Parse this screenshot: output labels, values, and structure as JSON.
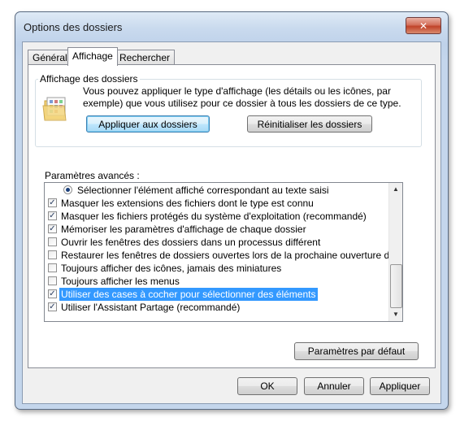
{
  "window": {
    "title": "Options des dossiers",
    "close_glyph": "✕"
  },
  "tabs": [
    "Général",
    "Affichage",
    "Rechercher"
  ],
  "active_tab": "Affichage",
  "folder_views": {
    "title": "Affichage des dossiers",
    "description": "Vous pouvez appliquer le type d'affichage (les détails ou les icônes, par exemple) que vous utilisez pour ce dossier à tous les dossiers de ce type.",
    "apply_button": "Appliquer aux dossiers",
    "reset_button": "Réinitialiser les dossiers",
    "icon": "folder-views-icon"
  },
  "advanced": {
    "label": "Paramètres avancés :",
    "items": [
      {
        "type": "radio",
        "checked": true,
        "label": "Sélectionner l'élément affiché correspondant au texte saisi"
      },
      {
        "type": "checkbox",
        "checked": true,
        "label": "Masquer les extensions des fichiers dont le type est connu"
      },
      {
        "type": "checkbox",
        "checked": true,
        "label": "Masquer les fichiers protégés du système d'exploitation (recommandé)"
      },
      {
        "type": "checkbox",
        "checked": true,
        "label": "Mémoriser les paramètres d'affichage de chaque dossier"
      },
      {
        "type": "checkbox",
        "checked": false,
        "label": "Ouvrir les fenêtres des dossiers dans un processus différent"
      },
      {
        "type": "checkbox",
        "checked": false,
        "label": "Restaurer les fenêtres de dossiers ouvertes lors de la prochaine ouverture de session"
      },
      {
        "type": "checkbox",
        "checked": false,
        "label": "Toujours afficher des icônes, jamais des miniatures"
      },
      {
        "type": "checkbox",
        "checked": false,
        "label": "Toujours afficher les menus"
      },
      {
        "type": "checkbox",
        "checked": true,
        "selected": true,
        "label": "Utiliser des cases à cocher pour sélectionner des éléments"
      },
      {
        "type": "checkbox",
        "checked": true,
        "label": "Utiliser l'Assistant Partage (recommandé)"
      }
    ],
    "defaults_button": "Paramètres par défaut"
  },
  "footer": {
    "ok": "OK",
    "cancel": "Annuler",
    "apply": "Appliquer"
  }
}
